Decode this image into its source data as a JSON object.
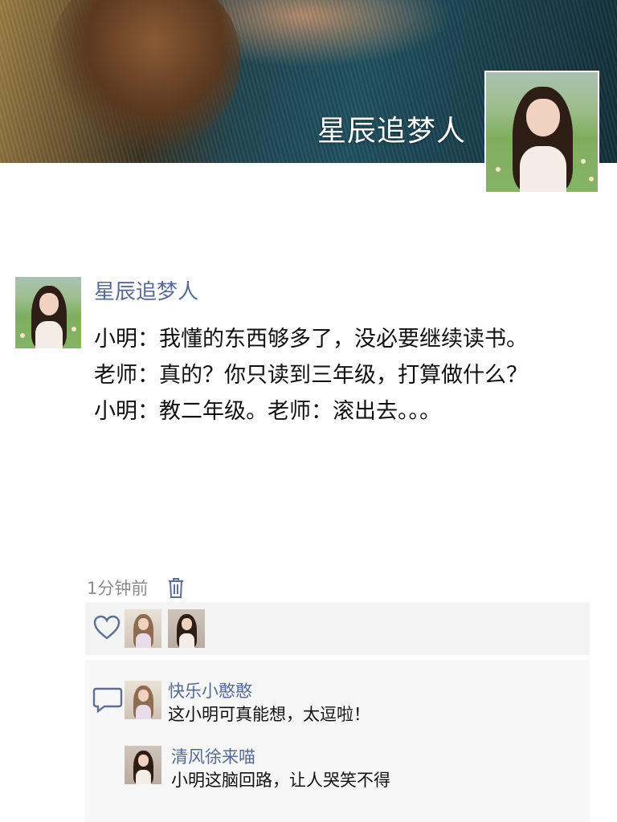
{
  "cover": {
    "title": "星辰追梦人"
  },
  "post": {
    "author": "星辰追梦人",
    "lines": [
      "小明：我懂的东西够多了，没必要继续读书。",
      "老师：真的？你只读到三年级，打算做什么？",
      "小明：教二年级。老师：滚出去。。。"
    ],
    "time": "1分钟前"
  },
  "likes": {
    "icon": "heart-outline-icon",
    "avatars": [
      "liker-avatar-1",
      "liker-avatar-2"
    ]
  },
  "comments": {
    "icon": "comment-bubble-icon",
    "items": [
      {
        "name": "快乐小憨憨",
        "text": "这小明可真能想，太逗啦！"
      },
      {
        "name": "清风徐来喵",
        "text": "小明这脑回路，让人哭笑不得"
      }
    ]
  },
  "colors": {
    "link": "#576b95",
    "text": "#111111",
    "meta": "#8c8c8c",
    "icon": "#5c6f95"
  }
}
